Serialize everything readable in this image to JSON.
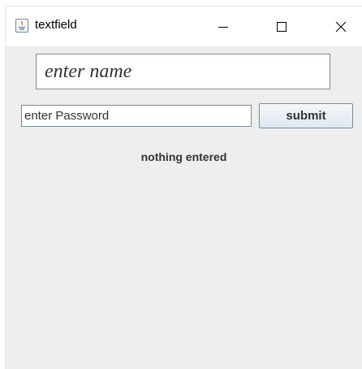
{
  "window": {
    "title": "textfield",
    "icon": "java-app-icon"
  },
  "titlebar_buttons": {
    "minimize": "minimize-icon",
    "maximize": "maximize-icon",
    "close": "close-icon"
  },
  "form": {
    "name_field": {
      "value": "enter name"
    },
    "password_field": {
      "value": "enter Password"
    },
    "submit_label": "submit",
    "status_text": "nothing entered"
  },
  "colors": {
    "panel_background": "#eeeeee",
    "field_border": "#7a8a9a",
    "text": "#333333"
  }
}
